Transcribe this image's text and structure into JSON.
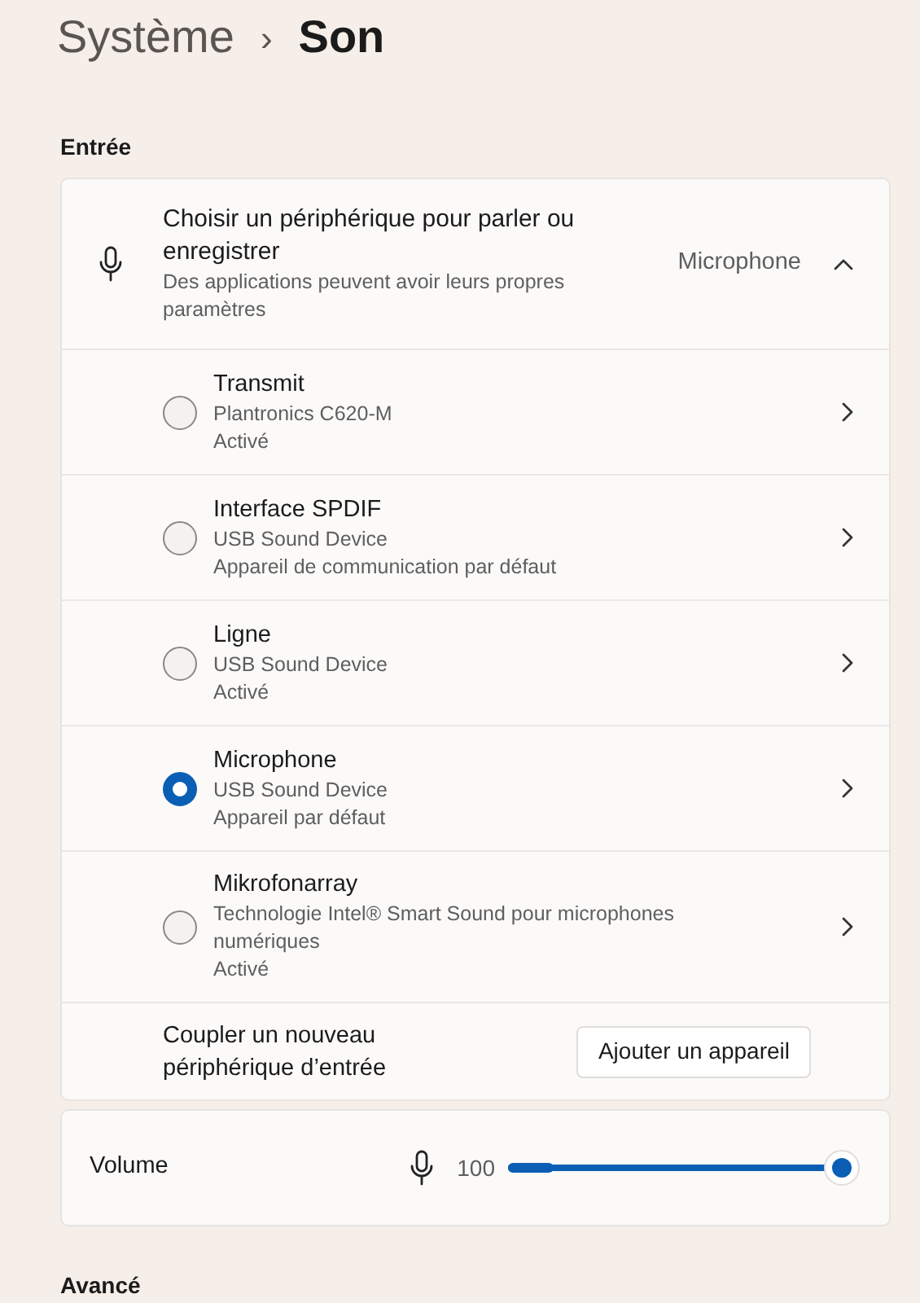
{
  "breadcrumb": {
    "parent": "Système",
    "separator": "›",
    "current": "Son"
  },
  "input_section": {
    "heading": "Entrée",
    "selector": {
      "title": "Choisir un périphérique pour parler ou enregistrer",
      "description": "Des applications peuvent avoir leurs propres paramètres",
      "value": "Microphone",
      "expanded": true
    },
    "devices": [
      {
        "name": "Transmit",
        "detail": "Plantronics C620-M",
        "status": "Activé",
        "selected": false
      },
      {
        "name": "Interface SPDIF",
        "detail": "USB Sound Device",
        "status": "Appareil de communication par défaut",
        "selected": false
      },
      {
        "name": "Ligne",
        "detail": "USB Sound Device",
        "status": "Activé",
        "selected": false
      },
      {
        "name": "Microphone",
        "detail": "USB Sound Device",
        "status": "Appareil par défaut",
        "selected": true
      },
      {
        "name": "Mikrofonarray",
        "detail": "Technologie Intel® Smart Sound pour microphones numériques",
        "status": "Activé",
        "selected": false
      }
    ],
    "pair": {
      "label": "Coupler un nouveau périphérique d’entrée",
      "button": "Ajouter un appareil"
    },
    "volume": {
      "label": "Volume",
      "reading": "100"
    }
  },
  "advanced_heading": "Avancé"
}
